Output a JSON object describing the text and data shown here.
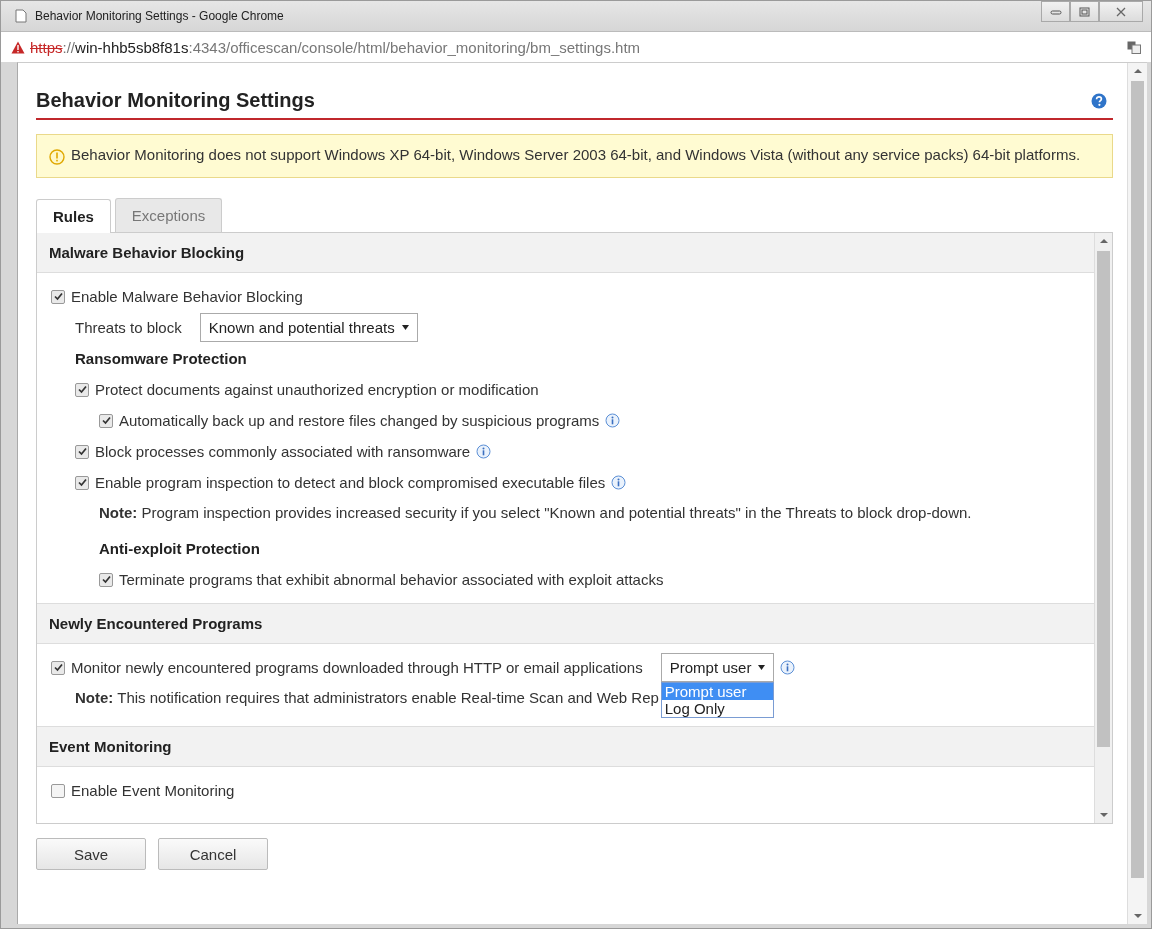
{
  "window": {
    "title": "Behavior Monitoring Settings - Google Chrome"
  },
  "address_bar": {
    "insecure": true,
    "scheme": "https",
    "separator": "://",
    "host": "win-hhb5sb8f81s",
    "path": ":4343/officescan/console/html/behavior_monitoring/bm_settings.htm"
  },
  "page_title": "Behavior Monitoring Settings",
  "warning": "Behavior Monitoring does not support Windows XP 64-bit, Windows Server 2003 64-bit, and Windows Vista (without any service packs) 64-bit platforms.",
  "tabs": [
    {
      "label": "Rules",
      "selected": true
    },
    {
      "label": "Exceptions",
      "selected": false
    }
  ],
  "sections": [
    {
      "title": "Malware Behavior Blocking",
      "items": [
        {
          "kind": "checkbox",
          "label": "Enable Malware Behavior Blocking",
          "checked": true,
          "children": [
            {
              "kind": "select",
              "label": "Threats to block",
              "select": {
                "value": "Known and potential threats"
              }
            },
            {
              "kind": "heading",
              "label": "Ransomware Protection",
              "children": [
                {
                  "kind": "checkbox",
                  "label": "Protect documents against unauthorized encryption or modification",
                  "checked": true,
                  "children": [
                    {
                      "kind": "checkbox",
                      "label": "Automatically back up and restore files changed by suspicious programs",
                      "checked": true,
                      "info": true
                    }
                  ]
                },
                {
                  "kind": "checkbox",
                  "label": "Block processes commonly associated with ransomware",
                  "checked": true,
                  "info": true
                },
                {
                  "kind": "checkbox",
                  "label": "Enable program inspection to detect and block compromised executable files",
                  "checked": true,
                  "info": true,
                  "children": [
                    {
                      "kind": "note",
                      "text": "**Note:** Program inspection provides increased security if you select \"Known and potential threats\" in the Threats to block drop-down."
                    },
                    {
                      "kind": "heading",
                      "label": "Anti-exploit Protection",
                      "children": [
                        {
                          "kind": "checkbox",
                          "label": "Terminate programs that exhibit abnormal behavior associated with exploit attacks",
                          "checked": true
                        }
                      ]
                    }
                  ]
                }
              ]
            }
          ]
        }
      ]
    },
    {
      "title": "Newly Encountered Programs",
      "items": [
        {
          "kind": "checkbox",
          "label": "Monitor newly encountered programs downloaded through HTTP or email applications",
          "checked": true,
          "info": true,
          "select": {
            "value": "Prompt user",
            "expanded": true,
            "options": [
              {
                "label": "Prompt user",
                "selected": true
              },
              {
                "label": "Log Only",
                "selected": false
              }
            ]
          },
          "children": [
            {
              "kind": "note",
              "text": "**Note:** This notification requires that administrators enable Real-time Scan and Web Rep"
            }
          ]
        }
      ]
    },
    {
      "title": "Event Monitoring",
      "items": [
        {
          "kind": "checkbox",
          "label": "Enable Event Monitoring",
          "checked": false
        }
      ]
    }
  ],
  "buttons": [
    "Save",
    "Cancel"
  ]
}
